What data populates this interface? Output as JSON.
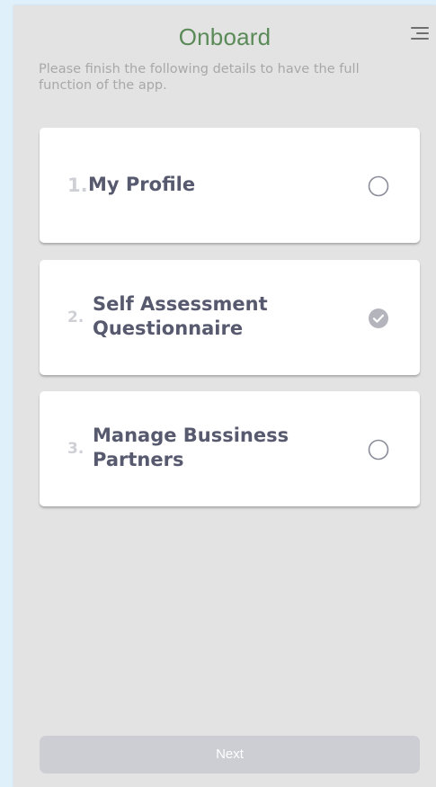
{
  "header": {
    "title": "Onboard",
    "menu_icon": "menu-icon"
  },
  "intro": {
    "text": "Please finish the following details to have the full function of the app."
  },
  "steps": [
    {
      "number": "1.",
      "label": "My Profile",
      "status": "incomplete",
      "status_icon": "empty-circle-icon"
    },
    {
      "number": "2.",
      "label": "Self Assessment Questionnaire",
      "status": "complete",
      "status_icon": "check-circle-icon"
    },
    {
      "number": "3.",
      "label": "Manage Bussiness Partners",
      "status": "incomplete",
      "status_icon": "empty-circle-icon"
    }
  ],
  "footer": {
    "next_label": "Next"
  },
  "colors": {
    "title_green": "#5a8a57",
    "card_text": "#575a6e",
    "number_muted": "#cfd0d6",
    "button_disabled": "#cdcdd4",
    "background": "#e3e3e3"
  }
}
